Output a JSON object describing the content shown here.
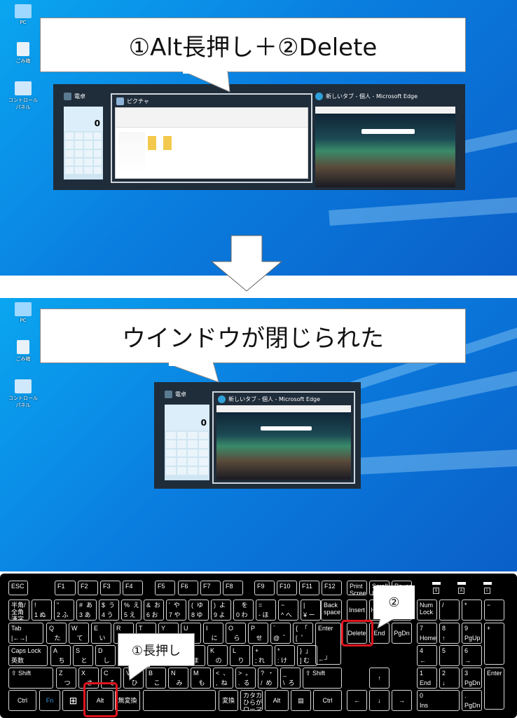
{
  "desktop_icons": [
    {
      "label": "PC",
      "icon": "pc-icon"
    },
    {
      "label": "ごみ箱",
      "icon": "recycle-bin-icon"
    },
    {
      "label": "コントロール パネル",
      "icon": "control-panel-icon"
    }
  ],
  "step1": {
    "callout": "①Alt長押し＋②Delete",
    "windows": [
      {
        "title": "電卓",
        "icon": "calculator-icon",
        "display": "0"
      },
      {
        "title": "ピクチャ",
        "icon": "pictures-folder-icon"
      },
      {
        "title": "新しいタブ - 個人 - Microsoft Edge",
        "icon": "edge-icon"
      }
    ]
  },
  "step2": {
    "callout": "ウインドウが閉じられた",
    "windows": [
      {
        "title": "電卓",
        "icon": "calculator-icon",
        "display": "0"
      },
      {
        "title": "新しいタブ - 個人 - Microsoft Edge",
        "icon": "edge-icon"
      }
    ]
  },
  "keyboard": {
    "callout_hold": "①長押し",
    "callout_delete": "②",
    "indicators": [
      "9",
      "A",
      "⇩"
    ],
    "highlight_color": "#e0141e",
    "keys": [
      {
        "m": "ESC"
      },
      {
        "m": "F1"
      },
      {
        "m": "F2"
      },
      {
        "m": "F3"
      },
      {
        "m": "F4"
      },
      {
        "m": "F5"
      },
      {
        "m": "F6"
      },
      {
        "m": "F7"
      },
      {
        "m": "F8"
      },
      {
        "m": "F9"
      },
      {
        "m": "F10"
      },
      {
        "m": "F11"
      },
      {
        "m": "F12"
      },
      {
        "m": "Print\nScreen"
      },
      {
        "m": "Scroll\nLock"
      },
      {
        "m": "Pause"
      },
      {
        "m": "半角/\n全角\n漢字"
      },
      {
        "m": "!",
        "s": "1 ぬ"
      },
      {
        "m": "\"",
        "s": "2 ふ"
      },
      {
        "m": "#  あ",
        "s": "3 あ"
      },
      {
        "m": "$  う",
        "s": "4 う"
      },
      {
        "m": "%  え",
        "s": "5 え"
      },
      {
        "m": "&  お",
        "s": "6 お"
      },
      {
        "m": "'  や",
        "s": "7 や"
      },
      {
        "m": "(  ゆ",
        "s": "8 ゆ"
      },
      {
        "m": ")  よ",
        "s": "9 よ"
      },
      {
        "m": "   を",
        "s": "0 わ"
      },
      {
        "m": "=",
        "s": "- ほ"
      },
      {
        "m": "~",
        "s": "^ へ"
      },
      {
        "m": "|",
        "s": "¥ ー"
      },
      {
        "m": "Back\nspace"
      },
      {
        "m": "Insert"
      },
      {
        "m": "Home"
      },
      {
        "m": "PgUp"
      },
      {
        "m": "Num\nLock"
      },
      {
        "m": "/"
      },
      {
        "m": "*"
      },
      {
        "m": "−"
      },
      {
        "m": "Tab",
        "s": "|←→|"
      },
      {
        "m": "Q",
        "s": "   た"
      },
      {
        "m": "W",
        "s": "   て"
      },
      {
        "m": "E",
        "s": "   い"
      },
      {
        "m": "R",
        "s": "   す"
      },
      {
        "m": "T",
        "s": "   か"
      },
      {
        "m": "Y",
        "s": "   ん"
      },
      {
        "m": "U",
        "s": "   な"
      },
      {
        "m": "I",
        "s": "   に"
      },
      {
        "m": "O",
        "s": "   ら"
      },
      {
        "m": "P",
        "s": "   せ"
      },
      {
        "m": "`",
        "s": "@  ゛"
      },
      {
        "m": "{  「",
        "s": "[  ゜"
      },
      {
        "m": "Enter",
        "s": "←┘"
      },
      {
        "m": "Delete"
      },
      {
        "m": "End"
      },
      {
        "m": "PgDn"
      },
      {
        "m": "7",
        "s": "Home"
      },
      {
        "m": "8",
        "s": "↑"
      },
      {
        "m": "9",
        "s": "PgUp"
      },
      {
        "m": "+"
      },
      {
        "m": "Caps Lock",
        "s": "英数"
      },
      {
        "m": "A",
        "s": "   ち"
      },
      {
        "m": "S",
        "s": "   と"
      },
      {
        "m": "D",
        "s": "   し"
      },
      {
        "m": "F",
        "s": "   は"
      },
      {
        "m": "G",
        "s": "   き"
      },
      {
        "m": "H",
        "s": "   く"
      },
      {
        "m": "J",
        "s": "   ま"
      },
      {
        "m": "K",
        "s": "   の"
      },
      {
        "m": "L",
        "s": "   り"
      },
      {
        "m": "+",
        "s": "; れ"
      },
      {
        "m": "*",
        "s": ": け"
      },
      {
        "m": "}  」",
        "s": "] む"
      },
      {
        "m": "4",
        "s": "←"
      },
      {
        "m": "5"
      },
      {
        "m": "6",
        "s": "→"
      },
      {
        "m": "⇧ Shift"
      },
      {
        "m": "Z",
        "s": "   つ"
      },
      {
        "m": "X",
        "s": "   さ"
      },
      {
        "m": "C",
        "s": "   そ"
      },
      {
        "m": "V",
        "s": "   ひ"
      },
      {
        "m": "B",
        "s": "   こ"
      },
      {
        "m": "N",
        "s": "   み"
      },
      {
        "m": "M",
        "s": "   も"
      },
      {
        "m": "<  、",
        "s": ",  ね"
      },
      {
        "m": ">  。",
        "s": ".  る"
      },
      {
        "m": "?  ・",
        "s": "/  め"
      },
      {
        "m": "_",
        "s": "\\  ろ"
      },
      {
        "m": "⇧ Shift"
      },
      {
        "m": "↑"
      },
      {
        "m": "1",
        "s": "End"
      },
      {
        "m": "2",
        "s": "↓"
      },
      {
        "m": "3",
        "s": "PgDn"
      },
      {
        "m": "Enter"
      },
      {
        "m": "Ctrl"
      },
      {
        "m": "Fn"
      },
      {
        "m": "⊞"
      },
      {
        "m": "Alt"
      },
      {
        "m": "無変換"
      },
      {
        "m": ""
      },
      {
        "m": "変換"
      },
      {
        "m": "カタカナ\nひらがな\nローマ字"
      },
      {
        "m": "Alt"
      },
      {
        "m": "▤"
      },
      {
        "m": "Ctrl"
      },
      {
        "m": "←"
      },
      {
        "m": "↓"
      },
      {
        "m": "→"
      },
      {
        "m": "0",
        "s": "Ins"
      },
      {
        "m": ".",
        "s": "PgDn"
      }
    ]
  }
}
